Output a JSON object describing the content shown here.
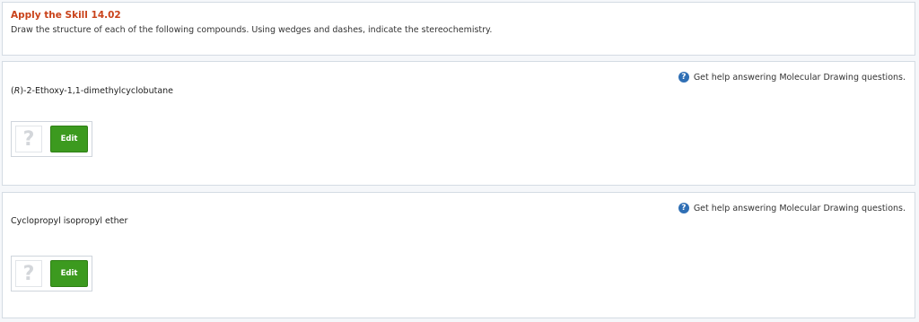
{
  "header": {
    "title": "Apply the Skill 14.02",
    "instructions": "Draw the structure of each of the following compounds. Using wedges and dashes, indicate the stereochemistry."
  },
  "questions": [
    {
      "help_text": "Get help answering Molecular Drawing questions.",
      "compound_prefix": "R",
      "compound_name": "-2-Ethoxy-1,1-dimethylcyclobutane",
      "preview_placeholder": "?",
      "edit_label": "Edit"
    },
    {
      "help_text": "Get help answering Molecular Drawing questions.",
      "compound_name": "Cyclopropyl isopropyl ether",
      "preview_placeholder": "?",
      "edit_label": "Edit"
    }
  ],
  "icons": {
    "help": "help-circle-icon",
    "help_glyph": "?"
  },
  "colors": {
    "title": "#c9421a",
    "edit_button": "#3c9a1f",
    "help_icon": "#2f6fb5"
  }
}
